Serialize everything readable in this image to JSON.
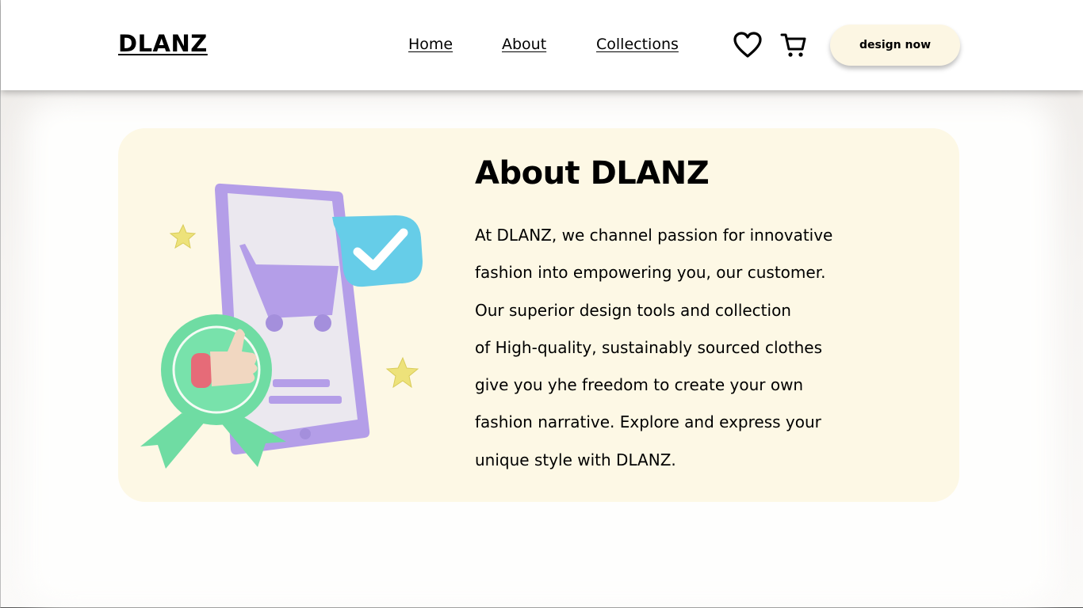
{
  "brand": {
    "logo": "DLANZ"
  },
  "nav": {
    "home": "Home",
    "about": "About",
    "collections": "Collections"
  },
  "header_icons": [
    "heart-icon",
    "cart-icon"
  ],
  "cta": {
    "label": "design now"
  },
  "about": {
    "title": "About DLANZ",
    "lines": [
      "At DLANZ, we channel passion for innovative",
      "fashion into empowering you, our customer.",
      "Our superior design tools and collection",
      "of High-quality, sustainably sourced clothes",
      "give you yhe freedom to create your own",
      "fashion narrative. Explore and express your",
      "unique style with DLANZ."
    ]
  },
  "colors": {
    "card_bg": "#fdf8e5",
    "button_bg": "#fcf6e3",
    "phone": "#b49ee8",
    "badge": "#6fdca3",
    "check_bubble": "#66cde8",
    "star": "#ede27a"
  }
}
